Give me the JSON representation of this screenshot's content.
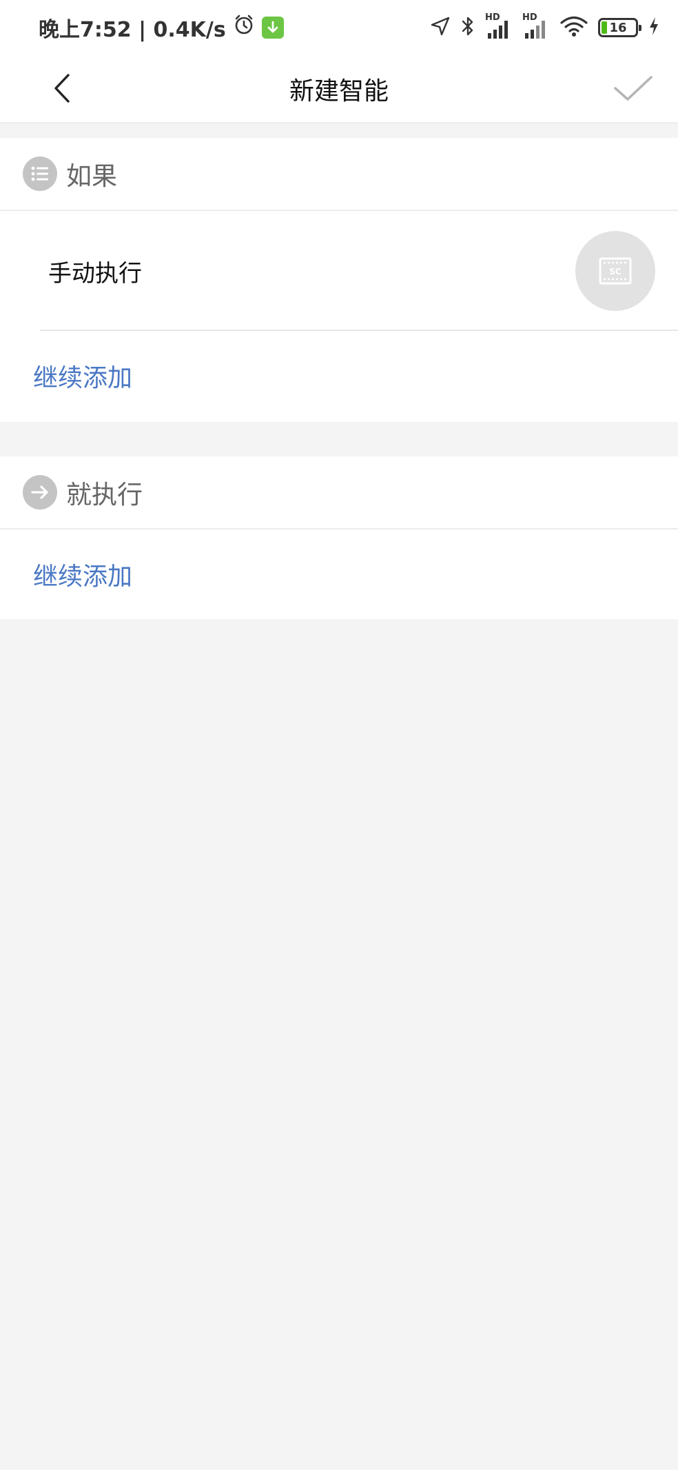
{
  "status_bar": {
    "time_speed": "晚上7:52 | 0.4K/s",
    "network_label_1": "HD",
    "network_label_2": "HD",
    "battery_level": "16",
    "icons": [
      "alarm-icon",
      "download-icon",
      "location-icon",
      "bluetooth-icon",
      "signal-icon",
      "signal-icon",
      "wifi-icon",
      "battery-icon",
      "charging-icon"
    ]
  },
  "nav": {
    "title": "新建智能",
    "back_icon": "chevron-left-icon",
    "confirm_icon": "check-icon"
  },
  "if_section": {
    "title": "如果",
    "icon": "list-icon",
    "condition_label": "手动执行",
    "condition_icon": "scene-icon",
    "condition_icon_text": "SC",
    "add_label": "继续添加"
  },
  "then_section": {
    "title": "就执行",
    "icon": "arrow-right-icon",
    "add_label": "继续添加"
  },
  "colors": {
    "accent": "#4a78c4",
    "background": "#f4f4f4",
    "icon_gray": "#c4c4c4",
    "battery_green": "#4cbb17",
    "download_green": "#6cc644"
  }
}
